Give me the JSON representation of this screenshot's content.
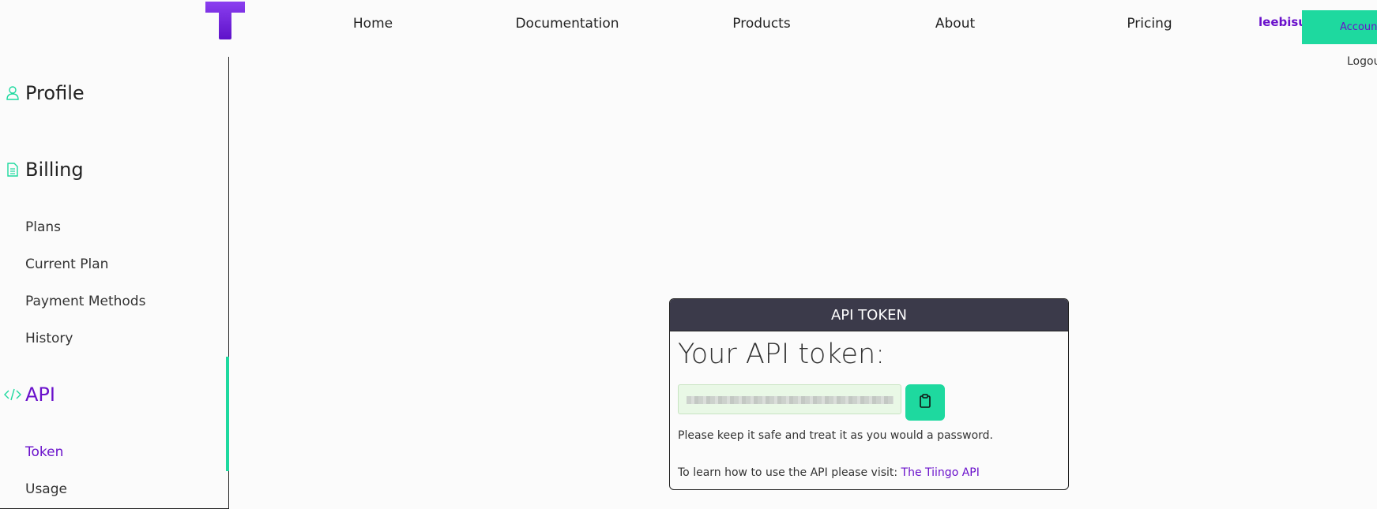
{
  "header": {
    "nav": [
      {
        "label": "Home"
      },
      {
        "label": "Documentation"
      },
      {
        "label": "Products"
      },
      {
        "label": "About"
      },
      {
        "label": "Pricing"
      }
    ],
    "username": "leebisu",
    "account_label": "Accoun",
    "logout_label": "Logou"
  },
  "sidebar": {
    "profile": {
      "label": "Profile",
      "icon": "user-icon"
    },
    "billing": {
      "label": "Billing",
      "icon": "document-icon",
      "items": [
        {
          "label": "Plans"
        },
        {
          "label": "Current Plan"
        },
        {
          "label": "Payment Methods"
        },
        {
          "label": "History"
        }
      ]
    },
    "api": {
      "label": "API",
      "icon": "code-icon",
      "items": [
        {
          "label": "Token",
          "active": true
        },
        {
          "label": "Usage"
        }
      ]
    }
  },
  "token_card": {
    "header": "API TOKEN",
    "title": "Your API token:",
    "token_value": "",
    "copy_icon": "clipboard-icon",
    "safety_note": "Please keep it safe and treat it as you would a password.",
    "learn_prefix": "To learn how to use the API please visit:",
    "learn_link": "The Tiingo API"
  },
  "colors": {
    "accent": "#1ed99f",
    "brand": "#6a11cb",
    "card_header": "#3b3a4a",
    "token_bg": "#e9f8e6"
  }
}
